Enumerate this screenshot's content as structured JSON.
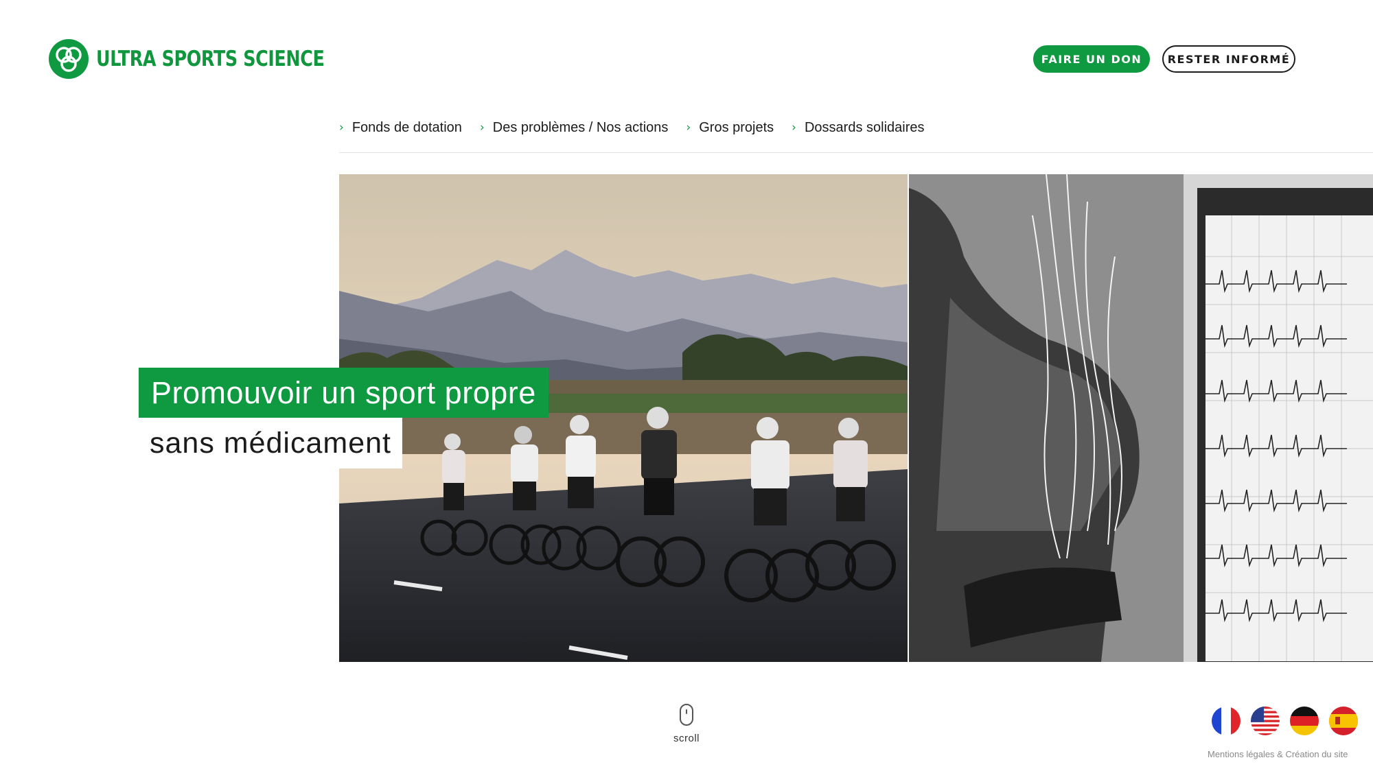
{
  "brand": {
    "name": "ULTRA SPORTS SCIENCE",
    "logo_icon": "three-rings-logo",
    "color": "#0f9a41"
  },
  "header": {
    "donate_label": "FAIRE UN DON",
    "inform_label": "RESTER INFORMÉ"
  },
  "nav": {
    "items": [
      {
        "label": "Fonds de dotation"
      },
      {
        "label": "Des problèmes / Nos actions"
      },
      {
        "label": "Gros projets"
      },
      {
        "label": "Dossards solidaires"
      }
    ]
  },
  "hero": {
    "headline_line1": "Promouvoir un sport propre",
    "headline_line2": "sans médicament",
    "left_image": "cyclists-peloton-mountains-photo",
    "right_image": "athlete-ecg-test-photo"
  },
  "scroll": {
    "label": "scroll",
    "icon": "mouse-icon"
  },
  "languages": [
    {
      "code": "fr",
      "icon": "flag-fr-icon"
    },
    {
      "code": "en-us",
      "icon": "flag-us-icon"
    },
    {
      "code": "de",
      "icon": "flag-de-icon"
    },
    {
      "code": "es",
      "icon": "flag-es-icon"
    }
  ],
  "footer": {
    "legal_label": "Mentions légales & Création du site"
  }
}
